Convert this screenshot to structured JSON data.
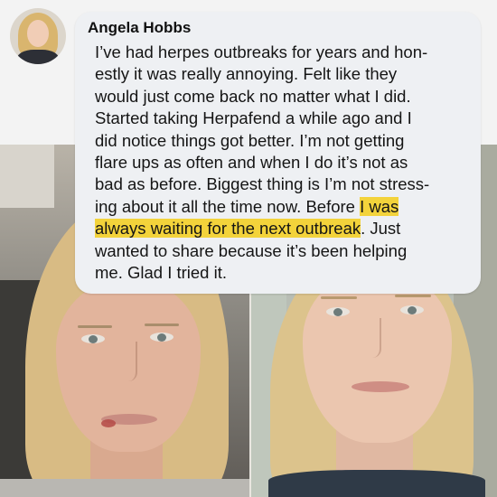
{
  "comment": {
    "author": "Angela Hobbs",
    "text_before": "I’ve had herpes outbreaks for years and hon-\nestly it was really annoying. Felt like they\nwould just come back no matter what I did.\nStarted taking Herpafend a while ago and I\ndid notice things got better. I’m not getting\nflare ups as often and when I do it’s not as\nbad as before. Biggest thing is I’m not stress-\ning about it all the time now. Before ",
    "text_highlight": "I was\nalways waiting for the next outbreak",
    "text_after": ". Just\nwanted to share because it’s been helping\nme. Glad I tried it.",
    "highlight_color": "#f3d33b"
  },
  "photos": {
    "left_icon": "before-photo",
    "right_icon": "after-photo"
  },
  "colors": {
    "bubble": "#eef0f3",
    "text": "#151515",
    "hair": "#dcc38c",
    "skin": "#e6bea4"
  }
}
